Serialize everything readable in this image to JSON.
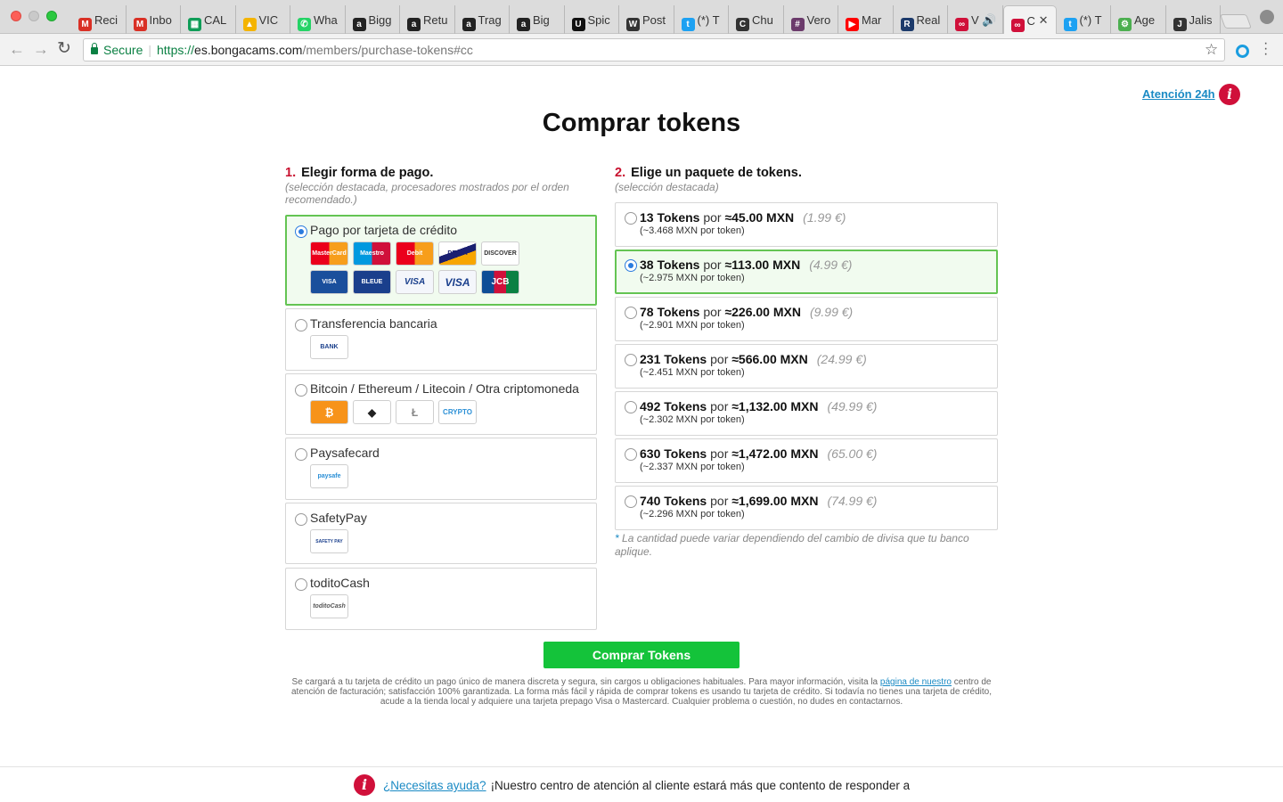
{
  "browser": {
    "tabs": [
      {
        "label": "Reci",
        "fav_color": "#d93025",
        "fav_glyph": "M"
      },
      {
        "label": "Inbo",
        "fav_color": "#d93025",
        "fav_glyph": "M"
      },
      {
        "label": "CAL",
        "fav_color": "#0f9d58",
        "fav_glyph": "▦"
      },
      {
        "label": "VIC",
        "fav_color": "#f4b400",
        "fav_glyph": "▲"
      },
      {
        "label": "Wha",
        "fav_color": "#25d366",
        "fav_glyph": "✆"
      },
      {
        "label": "Bigg",
        "fav_color": "#222222",
        "fav_glyph": "a"
      },
      {
        "label": "Retu",
        "fav_color": "#222222",
        "fav_glyph": "a"
      },
      {
        "label": "Trag",
        "fav_color": "#222222",
        "fav_glyph": "a"
      },
      {
        "label": "Big",
        "fav_color": "#222222",
        "fav_glyph": "a"
      },
      {
        "label": "Spic",
        "fav_color": "#111111",
        "fav_glyph": "U"
      },
      {
        "label": "Post",
        "fav_color": "#333333",
        "fav_glyph": "W"
      },
      {
        "label": "(*) T",
        "fav_color": "#1da1f2",
        "fav_glyph": "t"
      },
      {
        "label": "Chu",
        "fav_color": "#333333",
        "fav_glyph": "C"
      },
      {
        "label": "Vero",
        "fav_color": "#6b3a6b",
        "fav_glyph": "#"
      },
      {
        "label": "Mar",
        "fav_color": "#ff0000",
        "fav_glyph": "▶"
      },
      {
        "label": "Real",
        "fav_color": "#1c3a6b",
        "fav_glyph": "R"
      },
      {
        "label": "V 🔊",
        "fav_color": "#d0103a",
        "fav_glyph": "∞"
      },
      {
        "label": "C",
        "fav_color": "#d0103a",
        "fav_glyph": "∞",
        "active": true
      },
      {
        "label": "(*) T",
        "fav_color": "#1da1f2",
        "fav_glyph": "t"
      },
      {
        "label": "Age",
        "fav_color": "#4caf50",
        "fav_glyph": "⚙"
      },
      {
        "label": "Jalis",
        "fav_color": "#333333",
        "fav_glyph": "J"
      }
    ],
    "close_glyph": "✕",
    "secure_label": "Secure",
    "url_scheme": "https://",
    "url_host": "es.bongacams.com",
    "url_path": "/members/purchase-tokens#cc"
  },
  "header": {
    "help_link": "Atención 24h",
    "info_glyph": "i",
    "title": "Comprar tokens"
  },
  "payment": {
    "step_num": "1.",
    "title": "Elegir forma de pago.",
    "subtitle": "(selección destacada, procesadores mostrados por el orden recomendado.)",
    "methods": [
      {
        "label": "Pago por tarjeta de crédito",
        "selected": true,
        "logos": [
          "MasterCard",
          "Maestro",
          "Debit",
          "DELTA",
          "DISCOVER",
          "VISA Electron",
          "BLEUE VISA",
          "VISA DEBIT",
          "VISA",
          "JCB"
        ]
      },
      {
        "label": "Transferencia bancaria",
        "selected": false,
        "logos": [
          "BANK BANK"
        ]
      },
      {
        "label": "Bitcoin / Ethereum / Litecoin / Otra criptomoneda",
        "selected": false,
        "logos": [
          "₿",
          "◆",
          "Ł",
          "CRYPTO"
        ]
      },
      {
        "label": "Paysafecard",
        "selected": false,
        "logos": [
          "paysafe card"
        ]
      },
      {
        "label": "SafetyPay",
        "selected": false,
        "logos": [
          "SAFETY PAY"
        ]
      },
      {
        "label": "toditoCash",
        "selected": false,
        "logos": [
          "toditoCash"
        ]
      }
    ]
  },
  "packages": {
    "step_num": "2.",
    "title": "Elige un paquete de tokens.",
    "subtitle": "(selección destacada)",
    "por_label": "por",
    "items": [
      {
        "tokens": "13 Tokens",
        "mxn": "≈45.00 MXN",
        "eur": "(1.99 €)",
        "per": "(~3.468 MXN por token)",
        "selected": false
      },
      {
        "tokens": "38 Tokens",
        "mxn": "≈113.00 MXN",
        "eur": "(4.99 €)",
        "per": "(~2.975 MXN por token)",
        "selected": true
      },
      {
        "tokens": "78 Tokens",
        "mxn": "≈226.00 MXN",
        "eur": "(9.99 €)",
        "per": "(~2.901 MXN por token)",
        "selected": false
      },
      {
        "tokens": "231 Tokens",
        "mxn": "≈566.00 MXN",
        "eur": "(24.99 €)",
        "per": "(~2.451 MXN por token)",
        "selected": false
      },
      {
        "tokens": "492 Tokens",
        "mxn": "≈1,132.00 MXN",
        "eur": "(49.99 €)",
        "per": "(~2.302 MXN por token)",
        "selected": false
      },
      {
        "tokens": "630 Tokens",
        "mxn": "≈1,472.00 MXN",
        "eur": "(65.00 €)",
        "per": "(~2.337 MXN por token)",
        "selected": false
      },
      {
        "tokens": "740 Tokens",
        "mxn": "≈1,699.00 MXN",
        "eur": "(74.99 €)",
        "per": "(~2.296 MXN por token)",
        "selected": false
      }
    ],
    "note_asterisk": "*",
    "note": "La cantidad puede variar dependiendo del cambio de divisa que tu banco aplique."
  },
  "buy_button": "Comprar Tokens",
  "disclaimer": {
    "part1": "Se cargará a tu tarjeta de crédito un pago único de manera discreta y segura, sin cargos u obligaciones habituales. Para mayor información, visita la ",
    "link": "página de nuestro",
    "part2": " centro de atención de facturación; satisfacción 100% garantizada. La forma más fácil y rápida de comprar tokens es usando tu tarjeta de crédito. Si todavía no tienes una tarjeta de crédito, acude a la tienda local y adquiere una tarjeta prepago Visa o Mastercard. Cualquier problema o cuestión, no dudes en contactarnos."
  },
  "footer": {
    "help_link": "¿Necesitas ayuda?",
    "text": "¡Nuestro centro de atención al cliente estará más que contento de responder a"
  },
  "colors": {
    "accent_red": "#d0103a",
    "link_blue": "#1a8ac4",
    "selected_green": "#64c453",
    "button_green": "#14c33a"
  }
}
